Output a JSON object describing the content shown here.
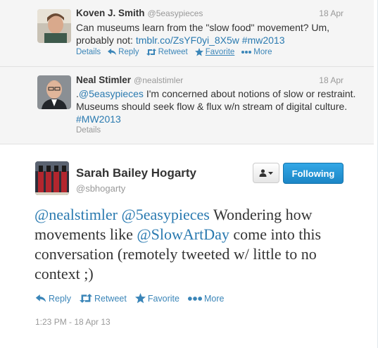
{
  "colors": {
    "link": "#2a7ab0",
    "action": "#3a85b8",
    "follow_bg": "#2b9ad8",
    "muted": "#999999"
  },
  "tweets": [
    {
      "name": "Koven J. Smith",
      "handle": "@5easypieces",
      "date": "18 Apr",
      "text_a": "Can museums learn from the \"slow food\" movement? Um, probably not: ",
      "link1": "tmblr.co/ZsYF0yi_8X5w",
      "hashtag": "#mw2013",
      "actions": {
        "details": "Details",
        "reply": "Reply",
        "retweet": "Retweet",
        "favorite": "Favorite",
        "more": "More"
      }
    },
    {
      "name": "Neal Stimler",
      "handle": "@nealstimler",
      "date": "18 Apr",
      "text_prefix": ".",
      "mention": "@5easypieces",
      "text_a": " I'm concerned about notions of slow or restraint. Museums should seek flow & flux w/n stream of digital culture. ",
      "hashtag": "#MW2013",
      "actions": {
        "details": "Details"
      }
    }
  ],
  "main": {
    "name": "Sarah Bailey Hogarty",
    "handle": "@sbhogarty",
    "follow_label": "Following",
    "mention1": "@nealstimler",
    "mention2": "@5easypieces",
    "text_a": " Wondering how movements like ",
    "mention3": "@SlowArtDay",
    "text_b": " come into this conversation (remotely tweeted w/ little to no context ;)",
    "actions": {
      "reply": "Reply",
      "retweet": "Retweet",
      "favorite": "Favorite",
      "more": "More"
    },
    "timestamp": "1:23 PM - 18 Apr 13"
  }
}
